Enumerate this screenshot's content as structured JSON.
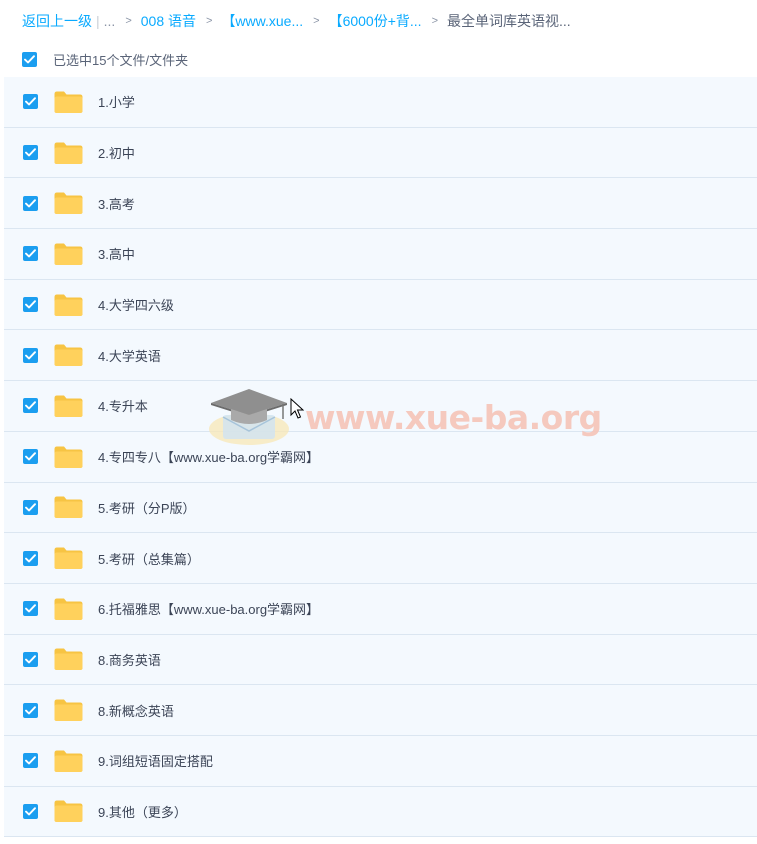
{
  "breadcrumb": {
    "back_label": "返回上一级",
    "ellipsis": "...",
    "crumbs": [
      "008 语音",
      "【www.xue...",
      "【6000份+背...",
      "最全单词库英语视..."
    ]
  },
  "selection": {
    "label": "已选中15个文件/文件夹",
    "checked": true
  },
  "folders": [
    {
      "name": "1.小学",
      "checked": true
    },
    {
      "name": "2.初中",
      "checked": true
    },
    {
      "name": "3.高考",
      "checked": true
    },
    {
      "name": "3.高中",
      "checked": true
    },
    {
      "name": "4.大学四六级",
      "checked": true
    },
    {
      "name": "4.大学英语",
      "checked": true
    },
    {
      "name": "4.专升本",
      "checked": true
    },
    {
      "name": "4.专四专八【www.xue-ba.org学霸网】",
      "checked": true
    },
    {
      "name": "5.考研（分P版）",
      "checked": true
    },
    {
      "name": "5.考研（总集篇）",
      "checked": true
    },
    {
      "name": "6.托福雅思【www.xue-ba.org学霸网】",
      "checked": true
    },
    {
      "name": "8.商务英语",
      "checked": true
    },
    {
      "name": "8.新概念英语",
      "checked": true
    },
    {
      "name": "9.词组短语固定搭配",
      "checked": true
    },
    {
      "name": "9.其他（更多）",
      "checked": true
    }
  ],
  "watermark": {
    "text": "www.xue-ba.org"
  },
  "colors": {
    "accent": "#09aaff",
    "checkbox": "#1b9ef0",
    "folder": "#ffd15c",
    "row_bg": "#f4f9fe"
  }
}
